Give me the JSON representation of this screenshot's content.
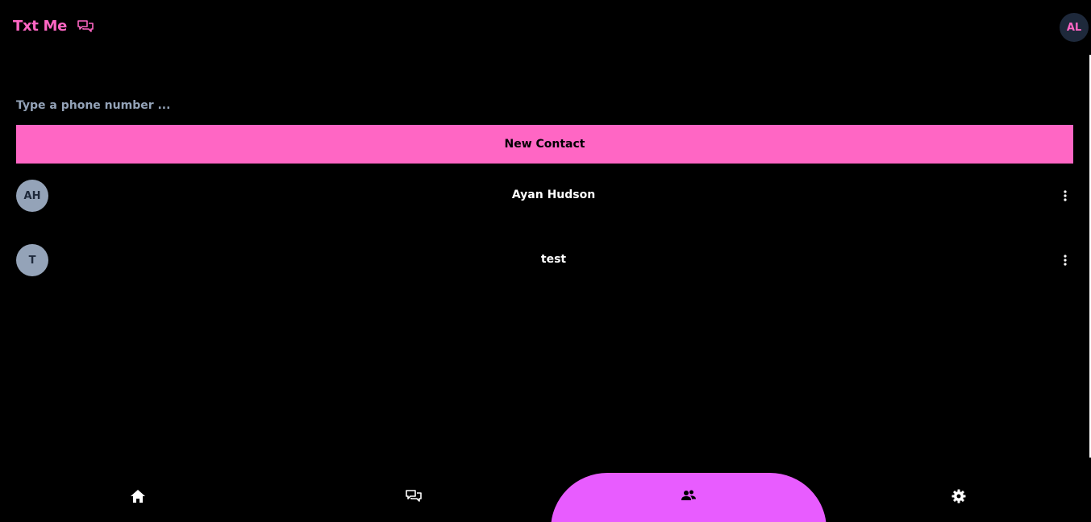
{
  "header": {
    "app_title": "Txt Me",
    "brand_icon": "chat-bubbles-icon",
    "user_initials": "AL"
  },
  "colors": {
    "accent": "#ff66c4",
    "nav_active": "#e85cff",
    "background": "#000000",
    "avatar_bg": "#94a3b8",
    "user_avatar_bg": "#1e293b"
  },
  "search": {
    "placeholder": "Type a phone number ...",
    "value": ""
  },
  "actions": {
    "new_contact_label": "New Contact"
  },
  "contacts": [
    {
      "initials": "AH",
      "name": "Ayan Hudson",
      "menu_icon": "more-vertical-icon"
    },
    {
      "initials": "T",
      "name": "test",
      "menu_icon": "more-vertical-icon"
    }
  ],
  "bottom_nav": {
    "items": [
      {
        "icon": "home-icon",
        "active": false
      },
      {
        "icon": "chat-bubbles-icon",
        "active": false
      },
      {
        "icon": "contacts-icon",
        "active": true
      },
      {
        "icon": "gear-icon",
        "active": false
      }
    ]
  }
}
